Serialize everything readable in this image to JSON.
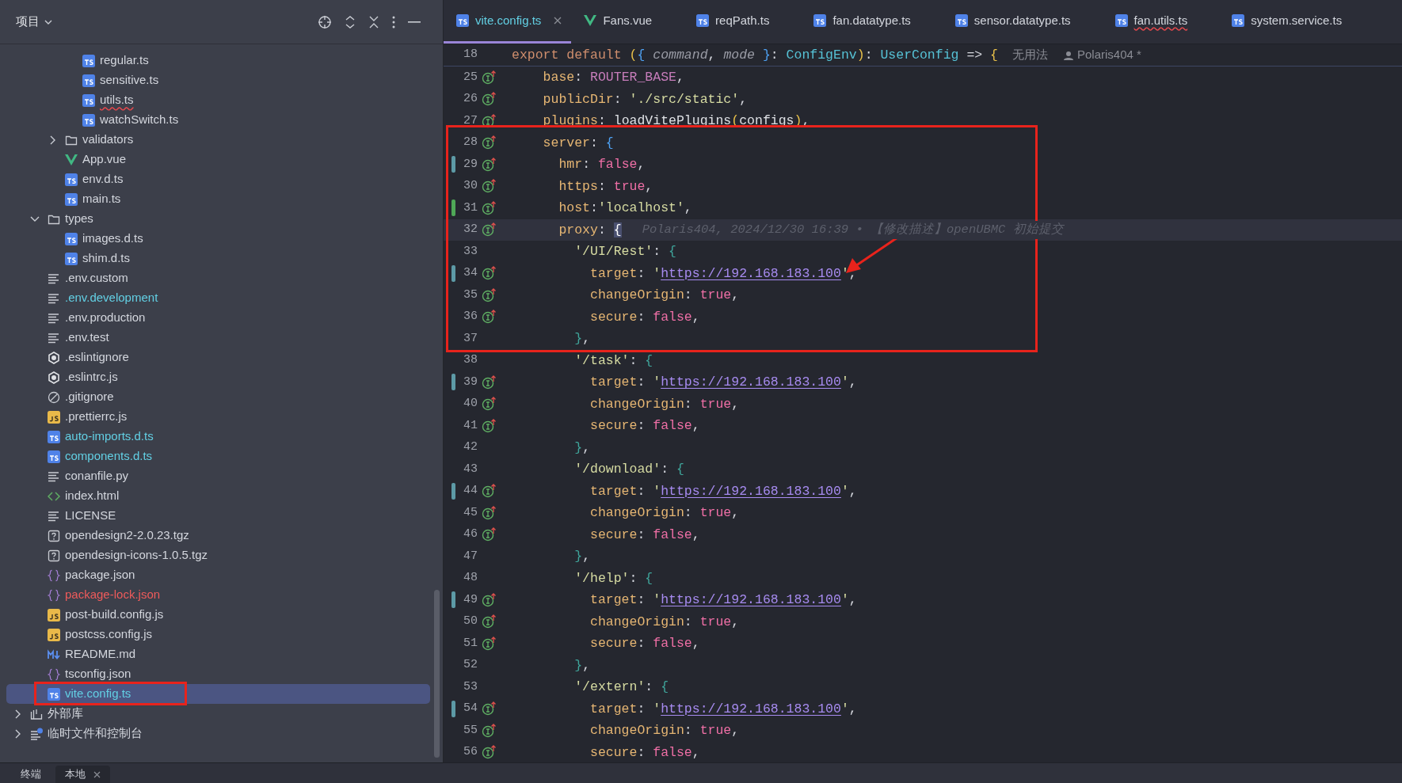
{
  "project_panel": {
    "title": "项目",
    "tree": [
      {
        "children": [
          {
            "children": [
              {
                "children": [
                  {
                    "label": "regular.ts",
                    "kind": "ts",
                    "added": false,
                    "conflict": false,
                    "squiggle": false,
                    "selected": false
                  },
                  {
                    "label": "sensitive.ts",
                    "kind": "ts",
                    "added": false,
                    "conflict": false,
                    "squiggle": false,
                    "selected": false
                  },
                  {
                    "label": "utils.ts",
                    "kind": "ts",
                    "added": false,
                    "conflict": false,
                    "squiggle": true,
                    "selected": false
                  },
                  {
                    "label": "watchSwitch.ts",
                    "kind": "ts",
                    "added": false,
                    "conflict": false,
                    "squiggle": false,
                    "selected": false
                  }
                ]
              },
              {
                "label": "validators",
                "kind": "folder",
                "added": false,
                "conflict": false,
                "squiggle": false,
                "selected": false,
                "expanded": false
              },
              {
                "label": "App.vue",
                "kind": "vue",
                "added": false,
                "conflict": false,
                "squiggle": false,
                "selected": false
              },
              {
                "label": "env.d.ts",
                "kind": "ts",
                "added": false,
                "conflict": false,
                "squiggle": false,
                "selected": false
              },
              {
                "label": "main.ts",
                "kind": "ts",
                "added": false,
                "conflict": false,
                "squiggle": false,
                "selected": false
              }
            ]
          },
          {
            "label": "types",
            "kind": "folder",
            "added": false,
            "conflict": false,
            "squiggle": false,
            "selected": false,
            "expanded": true,
            "children": [
              {
                "label": "images.d.ts",
                "kind": "ts",
                "added": false,
                "conflict": false,
                "squiggle": false,
                "selected": false
              },
              {
                "label": "shim.d.ts",
                "kind": "ts",
                "added": false,
                "conflict": false,
                "squiggle": false,
                "selected": false
              }
            ]
          },
          {
            "label": ".env.custom",
            "kind": "text",
            "added": false,
            "conflict": false,
            "squiggle": false,
            "selected": false
          },
          {
            "label": ".env.development",
            "kind": "text",
            "added": true,
            "conflict": false,
            "squiggle": false,
            "selected": false
          },
          {
            "label": ".env.production",
            "kind": "text",
            "added": false,
            "conflict": false,
            "squiggle": false,
            "selected": false
          },
          {
            "label": ".env.test",
            "kind": "text",
            "added": false,
            "conflict": false,
            "squiggle": false,
            "selected": false
          },
          {
            "label": ".eslintignore",
            "kind": "eslint",
            "added": false,
            "conflict": false,
            "squiggle": false,
            "selected": false
          },
          {
            "label": ".eslintrc.js",
            "kind": "eslint",
            "added": false,
            "conflict": false,
            "squiggle": false,
            "selected": false
          },
          {
            "label": ".gitignore",
            "kind": "ignore",
            "added": false,
            "conflict": false,
            "squiggle": false,
            "selected": false
          },
          {
            "label": ".prettierrc.js",
            "kind": "js",
            "added": false,
            "conflict": false,
            "squiggle": false,
            "selected": false
          },
          {
            "label": "auto-imports.d.ts",
            "kind": "ts",
            "added": true,
            "conflict": false,
            "squiggle": false,
            "selected": false
          },
          {
            "label": "components.d.ts",
            "kind": "ts",
            "added": true,
            "conflict": false,
            "squiggle": false,
            "selected": false
          },
          {
            "label": "conanfile.py",
            "kind": "text",
            "added": false,
            "conflict": false,
            "squiggle": false,
            "selected": false
          },
          {
            "label": "index.html",
            "kind": "html",
            "added": false,
            "conflict": false,
            "squiggle": false,
            "selected": false
          },
          {
            "label": "LICENSE",
            "kind": "text",
            "added": false,
            "conflict": false,
            "squiggle": false,
            "selected": false
          },
          {
            "label": "opendesign2-2.0.23.tgz",
            "kind": "unknown",
            "added": false,
            "conflict": false,
            "squiggle": false,
            "selected": false
          },
          {
            "label": "opendesign-icons-1.0.5.tgz",
            "kind": "unknown",
            "added": false,
            "conflict": false,
            "squiggle": false,
            "selected": false
          },
          {
            "label": "package.json",
            "kind": "json",
            "added": false,
            "conflict": false,
            "squiggle": false,
            "selected": false
          },
          {
            "label": "package-lock.json",
            "kind": "json",
            "added": false,
            "conflict": true,
            "squiggle": false,
            "selected": false
          },
          {
            "label": "post-build.config.js",
            "kind": "js",
            "added": false,
            "conflict": false,
            "squiggle": false,
            "selected": false
          },
          {
            "label": "postcss.config.js",
            "kind": "js",
            "added": false,
            "conflict": false,
            "squiggle": false,
            "selected": false
          },
          {
            "label": "README.md",
            "kind": "markdown",
            "added": false,
            "conflict": false,
            "squiggle": false,
            "selected": false
          },
          {
            "label": "tsconfig.json",
            "kind": "json",
            "added": false,
            "conflict": false,
            "squiggle": false,
            "selected": false
          },
          {
            "label": "vite.config.ts",
            "kind": "ts",
            "added": true,
            "conflict": false,
            "squiggle": false,
            "selected": true
          }
        ]
      },
      {
        "label": "外部库",
        "kind": "library",
        "added": false,
        "conflict": false,
        "squiggle": false,
        "selected": false,
        "expanded": false
      },
      {
        "label": "临时文件和控制台",
        "kind": "scratch",
        "added": false,
        "conflict": false,
        "squiggle": false,
        "selected": false,
        "expanded": false
      }
    ]
  },
  "tabs": [
    {
      "label": "vite.config.ts",
      "kind": "ts",
      "added": true,
      "conflict": false,
      "squiggle": false,
      "selected": true
    },
    {
      "label": "Fans.vue",
      "kind": "vue",
      "added": false,
      "conflict": false,
      "squiggle": false,
      "selected": false
    },
    {
      "label": "reqPath.ts",
      "kind": "ts",
      "added": false,
      "conflict": false,
      "squiggle": false,
      "selected": false
    },
    {
      "label": "fan.datatype.ts",
      "kind": "ts",
      "added": false,
      "conflict": false,
      "squiggle": false,
      "selected": false
    },
    {
      "label": "sensor.datatype.ts",
      "kind": "ts",
      "added": false,
      "conflict": false,
      "squiggle": false,
      "selected": false
    },
    {
      "label": "fan.utils.ts",
      "kind": "ts",
      "added": false,
      "conflict": false,
      "squiggle": true,
      "selected": false
    },
    {
      "label": "system.service.ts",
      "kind": "ts",
      "added": false,
      "conflict": false,
      "squiggle": false,
      "selected": false
    }
  ],
  "editor": {
    "sticky_line": {
      "number": "18",
      "usage_hint": "无用法",
      "author": "Polaris404 *",
      "tokens": [
        {
          "kind": "keyword",
          "text": "export default "
        },
        {
          "kind": "bracket_a",
          "text": "("
        },
        {
          "kind": "bracket_b",
          "text": "{ "
        },
        {
          "kind": "param",
          "text": "command"
        },
        {
          "kind": "punct",
          "text": ", "
        },
        {
          "kind": "param",
          "text": "mode"
        },
        {
          "kind": "bracket_b",
          "text": " }"
        },
        {
          "kind": "punct",
          "text": ": "
        },
        {
          "kind": "type",
          "text": "ConfigEnv"
        },
        {
          "kind": "bracket_a",
          "text": ")"
        },
        {
          "kind": "punct",
          "text": ": "
        },
        {
          "kind": "type",
          "text": "UserConfig"
        },
        {
          "kind": "punct",
          "text": " => "
        },
        {
          "kind": "bracket_a",
          "text": "{"
        }
      ]
    },
    "lines": [
      {
        "number": "25",
        "modified": false,
        "added": false,
        "override": true,
        "current": false,
        "tokens": [
          {
            "kind": "prop",
            "text": "    base"
          },
          {
            "kind": "punct",
            "text": ": "
          },
          {
            "kind": "constant",
            "text": "ROUTER_BASE"
          },
          {
            "kind": "punct",
            "text": ","
          }
        ]
      },
      {
        "number": "26",
        "modified": false,
        "added": false,
        "override": true,
        "current": false,
        "tokens": [
          {
            "kind": "prop",
            "text": "    publicDir"
          },
          {
            "kind": "punct",
            "text": ": "
          },
          {
            "kind": "string",
            "text": "'./src/static'"
          },
          {
            "kind": "punct",
            "text": ","
          }
        ]
      },
      {
        "number": "27",
        "modified": false,
        "added": false,
        "override": true,
        "current": false,
        "tokens": [
          {
            "kind": "prop",
            "text": "    plugins"
          },
          {
            "kind": "punct",
            "text": ": "
          },
          {
            "kind": "func",
            "text": "loadVitePlugins"
          },
          {
            "kind": "bracket_a",
            "text": "("
          },
          {
            "kind": "func",
            "text": "configs"
          },
          {
            "kind": "bracket_a",
            "text": ")"
          },
          {
            "kind": "punct",
            "text": ","
          }
        ]
      },
      {
        "number": "28",
        "modified": false,
        "added": false,
        "override": true,
        "current": false,
        "tokens": [
          {
            "kind": "prop",
            "text": "    server"
          },
          {
            "kind": "punct",
            "text": ": "
          },
          {
            "kind": "bracket_b",
            "text": "{"
          }
        ]
      },
      {
        "number": "29",
        "modified": true,
        "added": false,
        "override": true,
        "current": false,
        "tokens": [
          {
            "kind": "prop",
            "text": "      hmr"
          },
          {
            "kind": "punct",
            "text": ": "
          },
          {
            "kind": "bool",
            "text": "false"
          },
          {
            "kind": "punct",
            "text": ","
          }
        ]
      },
      {
        "number": "30",
        "modified": false,
        "added": false,
        "override": true,
        "current": false,
        "tokens": [
          {
            "kind": "prop",
            "text": "      https"
          },
          {
            "kind": "punct",
            "text": ": "
          },
          {
            "kind": "bool",
            "text": "true"
          },
          {
            "kind": "punct",
            "text": ","
          }
        ]
      },
      {
        "number": "31",
        "modified": false,
        "added": true,
        "override": true,
        "current": false,
        "tokens": [
          {
            "kind": "prop",
            "text": "      host"
          },
          {
            "kind": "punct",
            "text": ":"
          },
          {
            "kind": "string",
            "text": "'localhost'"
          },
          {
            "kind": "punct",
            "text": ","
          }
        ]
      },
      {
        "number": "32",
        "modified": false,
        "added": false,
        "override": true,
        "current": true,
        "blame": "Polaris404, 2024/12/30 16:39 • 【修改描述】openUBMC 初始提交",
        "tokens": [
          {
            "kind": "prop",
            "text": "      proxy"
          },
          {
            "kind": "punct",
            "text": ": "
          },
          {
            "kind": "bracket_match",
            "text": "{"
          }
        ]
      },
      {
        "number": "33",
        "modified": false,
        "added": false,
        "override": false,
        "current": false,
        "tokens": [
          {
            "kind": "string",
            "text": "        '/UI/Rest'"
          },
          {
            "kind": "punct",
            "text": ": "
          },
          {
            "kind": "bracket_c",
            "text": "{"
          }
        ]
      },
      {
        "number": "34",
        "modified": true,
        "added": false,
        "override": true,
        "current": false,
        "tokens": [
          {
            "kind": "prop",
            "text": "          target"
          },
          {
            "kind": "punct",
            "text": ": "
          },
          {
            "kind": "string",
            "text": "'"
          },
          {
            "kind": "url",
            "text": "https://192.168.183.100"
          },
          {
            "kind": "string",
            "text": "'"
          },
          {
            "kind": "punct",
            "text": ","
          }
        ]
      },
      {
        "number": "35",
        "modified": false,
        "added": false,
        "override": true,
        "current": false,
        "tokens": [
          {
            "kind": "prop",
            "text": "          changeOrigin"
          },
          {
            "kind": "punct",
            "text": ": "
          },
          {
            "kind": "bool",
            "text": "true"
          },
          {
            "kind": "punct",
            "text": ","
          }
        ]
      },
      {
        "number": "36",
        "modified": false,
        "added": false,
        "override": true,
        "current": false,
        "tokens": [
          {
            "kind": "prop",
            "text": "          secure"
          },
          {
            "kind": "punct",
            "text": ": "
          },
          {
            "kind": "bool",
            "text": "false"
          },
          {
            "kind": "punct",
            "text": ","
          }
        ]
      },
      {
        "number": "37",
        "modified": false,
        "added": false,
        "override": false,
        "current": false,
        "tokens": [
          {
            "kind": "bracket_c",
            "text": "        }"
          },
          {
            "kind": "punct",
            "text": ","
          }
        ]
      },
      {
        "number": "38",
        "modified": false,
        "added": false,
        "override": false,
        "current": false,
        "tokens": [
          {
            "kind": "string",
            "text": "        '/task'"
          },
          {
            "kind": "punct",
            "text": ": "
          },
          {
            "kind": "bracket_c",
            "text": "{"
          }
        ]
      },
      {
        "number": "39",
        "modified": true,
        "added": false,
        "override": true,
        "current": false,
        "tokens": [
          {
            "kind": "prop",
            "text": "          target"
          },
          {
            "kind": "punct",
            "text": ": "
          },
          {
            "kind": "string",
            "text": "'"
          },
          {
            "kind": "url",
            "text": "https://192.168.183.100"
          },
          {
            "kind": "string",
            "text": "'"
          },
          {
            "kind": "punct",
            "text": ","
          }
        ]
      },
      {
        "number": "40",
        "modified": false,
        "added": false,
        "override": true,
        "current": false,
        "tokens": [
          {
            "kind": "prop",
            "text": "          changeOrigin"
          },
          {
            "kind": "punct",
            "text": ": "
          },
          {
            "kind": "bool",
            "text": "true"
          },
          {
            "kind": "punct",
            "text": ","
          }
        ]
      },
      {
        "number": "41",
        "modified": false,
        "added": false,
        "override": true,
        "current": false,
        "tokens": [
          {
            "kind": "prop",
            "text": "          secure"
          },
          {
            "kind": "punct",
            "text": ": "
          },
          {
            "kind": "bool",
            "text": "false"
          },
          {
            "kind": "punct",
            "text": ","
          }
        ]
      },
      {
        "number": "42",
        "modified": false,
        "added": false,
        "override": false,
        "current": false,
        "tokens": [
          {
            "kind": "bracket_c",
            "text": "        }"
          },
          {
            "kind": "punct",
            "text": ","
          }
        ]
      },
      {
        "number": "43",
        "modified": false,
        "added": false,
        "override": false,
        "current": false,
        "tokens": [
          {
            "kind": "string",
            "text": "        '/download'"
          },
          {
            "kind": "punct",
            "text": ": "
          },
          {
            "kind": "bracket_c",
            "text": "{"
          }
        ]
      },
      {
        "number": "44",
        "modified": true,
        "added": false,
        "override": true,
        "current": false,
        "tokens": [
          {
            "kind": "prop",
            "text": "          target"
          },
          {
            "kind": "punct",
            "text": ": "
          },
          {
            "kind": "string",
            "text": "'"
          },
          {
            "kind": "url",
            "text": "https://192.168.183.100"
          },
          {
            "kind": "string",
            "text": "'"
          },
          {
            "kind": "punct",
            "text": ","
          }
        ]
      },
      {
        "number": "45",
        "modified": false,
        "added": false,
        "override": true,
        "current": false,
        "tokens": [
          {
            "kind": "prop",
            "text": "          changeOrigin"
          },
          {
            "kind": "punct",
            "text": ": "
          },
          {
            "kind": "bool",
            "text": "true"
          },
          {
            "kind": "punct",
            "text": ","
          }
        ]
      },
      {
        "number": "46",
        "modified": false,
        "added": false,
        "override": true,
        "current": false,
        "tokens": [
          {
            "kind": "prop",
            "text": "          secure"
          },
          {
            "kind": "punct",
            "text": ": "
          },
          {
            "kind": "bool",
            "text": "false"
          },
          {
            "kind": "punct",
            "text": ","
          }
        ]
      },
      {
        "number": "47",
        "modified": false,
        "added": false,
        "override": false,
        "current": false,
        "tokens": [
          {
            "kind": "bracket_c",
            "text": "        }"
          },
          {
            "kind": "punct",
            "text": ","
          }
        ]
      },
      {
        "number": "48",
        "modified": false,
        "added": false,
        "override": false,
        "current": false,
        "tokens": [
          {
            "kind": "string",
            "text": "        '/help'"
          },
          {
            "kind": "punct",
            "text": ": "
          },
          {
            "kind": "bracket_c",
            "text": "{"
          }
        ]
      },
      {
        "number": "49",
        "modified": true,
        "added": false,
        "override": true,
        "current": false,
        "tokens": [
          {
            "kind": "prop",
            "text": "          target"
          },
          {
            "kind": "punct",
            "text": ": "
          },
          {
            "kind": "string",
            "text": "'"
          },
          {
            "kind": "url",
            "text": "https://192.168.183.100"
          },
          {
            "kind": "string",
            "text": "'"
          },
          {
            "kind": "punct",
            "text": ","
          }
        ]
      },
      {
        "number": "50",
        "modified": false,
        "added": false,
        "override": true,
        "current": false,
        "tokens": [
          {
            "kind": "prop",
            "text": "          changeOrigin"
          },
          {
            "kind": "punct",
            "text": ": "
          },
          {
            "kind": "bool",
            "text": "true"
          },
          {
            "kind": "punct",
            "text": ","
          }
        ]
      },
      {
        "number": "51",
        "modified": false,
        "added": false,
        "override": true,
        "current": false,
        "tokens": [
          {
            "kind": "prop",
            "text": "          secure"
          },
          {
            "kind": "punct",
            "text": ": "
          },
          {
            "kind": "bool",
            "text": "false"
          },
          {
            "kind": "punct",
            "text": ","
          }
        ]
      },
      {
        "number": "52",
        "modified": false,
        "added": false,
        "override": false,
        "current": false,
        "tokens": [
          {
            "kind": "bracket_c",
            "text": "        }"
          },
          {
            "kind": "punct",
            "text": ","
          }
        ]
      },
      {
        "number": "53",
        "modified": false,
        "added": false,
        "override": false,
        "current": false,
        "tokens": [
          {
            "kind": "string",
            "text": "        '/extern'"
          },
          {
            "kind": "punct",
            "text": ": "
          },
          {
            "kind": "bracket_c",
            "text": "{"
          }
        ]
      },
      {
        "number": "54",
        "modified": true,
        "added": false,
        "override": true,
        "current": false,
        "tokens": [
          {
            "kind": "prop",
            "text": "          target"
          },
          {
            "kind": "punct",
            "text": ": "
          },
          {
            "kind": "string",
            "text": "'"
          },
          {
            "kind": "url",
            "text": "https://192.168.183.100"
          },
          {
            "kind": "string",
            "text": "'"
          },
          {
            "kind": "punct",
            "text": ","
          }
        ]
      },
      {
        "number": "55",
        "modified": false,
        "added": false,
        "override": true,
        "current": false,
        "tokens": [
          {
            "kind": "prop",
            "text": "          changeOrigin"
          },
          {
            "kind": "punct",
            "text": ": "
          },
          {
            "kind": "bool",
            "text": "true"
          },
          {
            "kind": "punct",
            "text": ","
          }
        ]
      },
      {
        "number": "56",
        "modified": false,
        "added": false,
        "override": true,
        "current": false,
        "tokens": [
          {
            "kind": "prop",
            "text": "          secure"
          },
          {
            "kind": "punct",
            "text": ": "
          },
          {
            "kind": "bool",
            "text": "false"
          },
          {
            "kind": "punct",
            "text": ","
          }
        ]
      }
    ]
  },
  "bottom_tabs": [
    {
      "label": "终端",
      "selected": false
    },
    {
      "label": "本地",
      "selected": true
    }
  ]
}
